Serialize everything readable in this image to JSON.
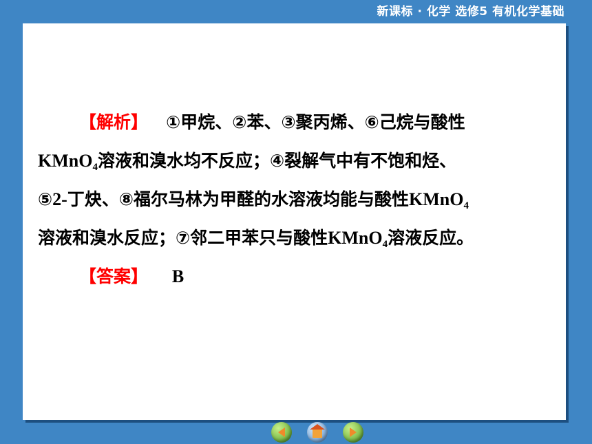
{
  "header": {
    "title": "新课标 · 化学  选修5  有机化学基础"
  },
  "analysis": {
    "label": "【解析】",
    "line1": "①甲烷、②苯、③聚丙烯、⑥己烷与酸性",
    "line2_pre": "KMnO",
    "line2_sub": "4",
    "line2_post": "溶液和溴水均不反应；④裂解气中有不饱和烃、",
    "line3_a": "⑤",
    "line3_b": "2-",
    "line3_c": "丁炔、⑧福尔马林为甲醛的水溶液均能与酸性",
    "line3_d": "KMnO",
    "line3_sub": "4",
    "line4_a": "溶液和溴水反应；⑦邻二甲苯只与酸性",
    "line4_b": "KMnO",
    "line4_sub": "4",
    "line4_c": "溶液反应。"
  },
  "answer": {
    "label": "【答案】",
    "value": "B"
  },
  "nav": {
    "buttons": [
      {
        "icon": "prev-arrow-icon"
      },
      {
        "icon": "home-icon"
      },
      {
        "icon": "next-arrow-icon"
      }
    ]
  },
  "colors": {
    "background": "#3f86c5",
    "bracket": "#ff0000",
    "panel": "#ffffff"
  }
}
